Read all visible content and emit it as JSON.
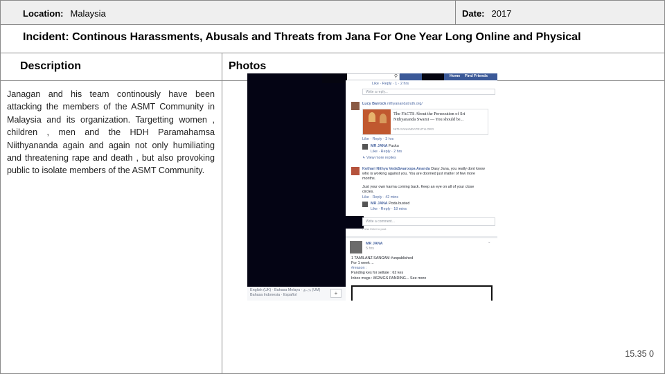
{
  "location": {
    "label": "Location:",
    "value": "Malaysia"
  },
  "date": {
    "label": "Date:",
    "value": "2017"
  },
  "incident": "Incident: Continous Harassments, Abusals and Threats from Jana For One Year Long Online and Physical",
  "headers": {
    "description": "Description",
    "photos": "Photos"
  },
  "description": "Janagan and his team continously have been attacking the members of the ASMT Community in Malaysia and its organization. Targetting women , children , men and the HDH Paramahamsa Niithyananda again and again not only humiliating and threatening rape and death , but also provoking public to isolate members of the ASMT Community.",
  "page_number": "15.35 0",
  "screenshot": {
    "nav": {
      "home": "Home",
      "find_friends": "Find Friends"
    },
    "top_actions": "Like · Reply · 1 · 2 hrs",
    "write_reply": "Write a reply...",
    "post1": {
      "author": "Lucy Barrock",
      "link": "nithyanandatruth.org/",
      "card_title_1": "The FACTS About the Persecution of Sri",
      "card_title_2": "Nithyananda Swami — You should be...",
      "card_domain": "NITHYANANDATRUTH.ORG",
      "actions": "Like · Reply · 3 hrs",
      "reply_author": "MR JANA",
      "reply_text": "Fucku",
      "reply_actions": "Like · Reply · 2 hrs",
      "view_more": "View more replies"
    },
    "post2": {
      "author": "Kothari Nithya VedaSwaroopa Ananda",
      "line1": "Dasy Jana, you really dont know",
      "line2": "who is working against you. You are doomed just matter of few more",
      "line3": "months.",
      "line4": "Just your own karma coming back. Keep an eye on all of your close",
      "line5": "circles.",
      "actions": "Like · Reply · 42 mins",
      "reply_author": "MR JANA",
      "reply_text": "Poda busted",
      "reply_actions": "Like · Reply · 18 mins"
    },
    "write_comment": "Write a comment...",
    "press_enter": "Press Enter to post.",
    "post3": {
      "author": "MR JANA",
      "time": "5 hrs",
      "line1": "1 TAMILANZ SANGAM #unpublished",
      "line2": "For 1 week ...",
      "line3": "#reason :",
      "line4": "Panding kes for settale : 62 kes",
      "line5": "Inbox msgs : 862MGS PANDING... See more"
    },
    "footer_line1": "English (UK) · Bahasa Melayu · த.அ (UM)",
    "footer_line2": "Bahasa Indonesia · Español",
    "plus": "+"
  }
}
